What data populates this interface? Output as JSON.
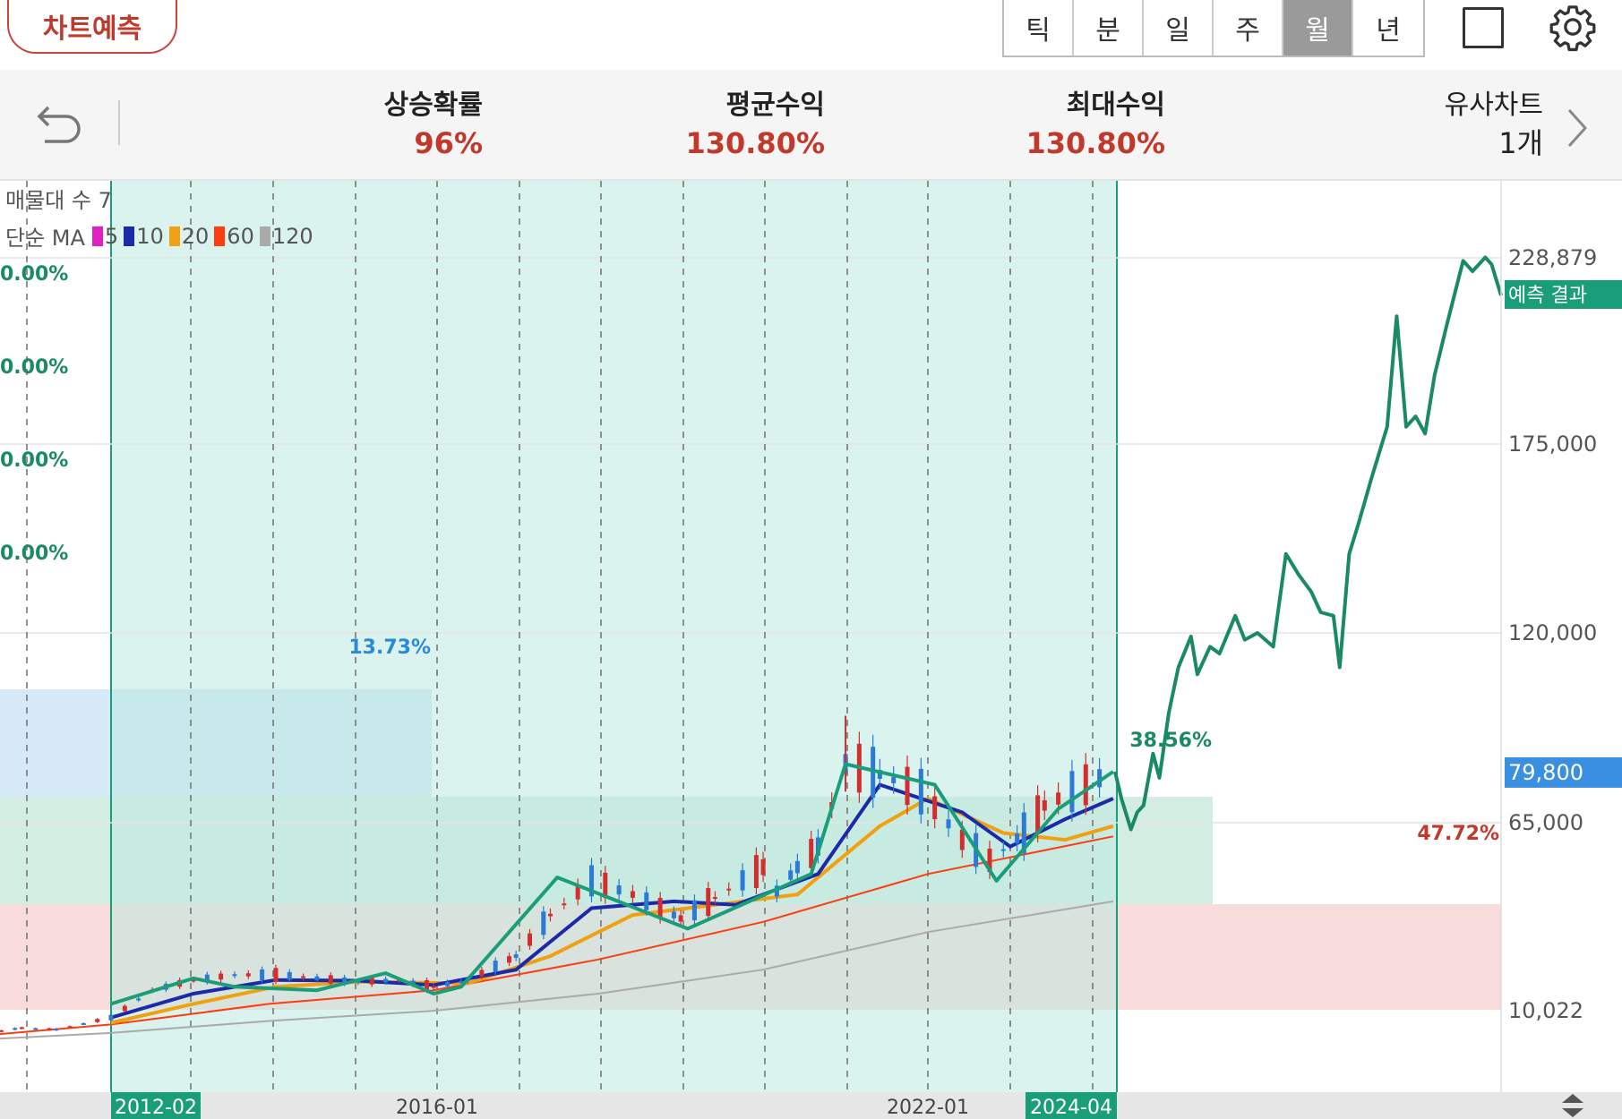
{
  "header": {
    "predict_button": "차트예측",
    "tabs": [
      {
        "label": "틱",
        "active": false
      },
      {
        "label": "분",
        "active": false
      },
      {
        "label": "일",
        "active": false
      },
      {
        "label": "주",
        "active": false
      },
      {
        "label": "월",
        "active": true
      },
      {
        "label": "년",
        "active": false
      }
    ]
  },
  "stats": {
    "rise_prob": {
      "label": "상승확률",
      "value": "96%"
    },
    "avg_return": {
      "label": "평균수익",
      "value": "130.80%"
    },
    "max_return": {
      "label": "최대수익",
      "value": "130.80%"
    },
    "similar": {
      "label": "유사차트",
      "value": "1개"
    }
  },
  "legend": {
    "volume_profile": "매물대 수 7",
    "ma_label": "단순 MA",
    "ma_items": [
      {
        "period": "5",
        "color": "#e020c0"
      },
      {
        "period": "10",
        "color": "#1a2aa8"
      },
      {
        "period": "20",
        "color": "#f0a010"
      },
      {
        "period": "60",
        "color": "#ff3c10"
      },
      {
        "period": "120",
        "color": "#aaaaaa"
      }
    ]
  },
  "chart_data": {
    "type": "line",
    "y_axis_labels": [
      "228,879",
      "175,000",
      "120,000",
      "65,000",
      "10,022"
    ],
    "y_axis_values": [
      228879,
      175000,
      120000,
      65000,
      10022
    ],
    "current_price": "79,800",
    "prediction_label": "예측 결과",
    "x_axis_labels": [
      "2012-02",
      "2016-01",
      "2022-01",
      "2024-04"
    ],
    "left_percent_labels": [
      "0.00%",
      "0.00%",
      "0.00%",
      "0.00%"
    ],
    "zone_labels": [
      "13.73%",
      "38.56%",
      "47.72%"
    ],
    "colors": {
      "zone_blue": "#d6e9f8",
      "zone_green": "#d3ede3",
      "zone_red": "#f8dcdc",
      "pattern": "#1a9e7a",
      "prediction": "#1a8a64",
      "highlight": "#bde9e0",
      "axis_badge": "#1a9e7a",
      "price_badge": "#3a8fe0"
    },
    "price_series": [
      [
        "2010-06",
        3000
      ],
      [
        "2011-01",
        5000
      ],
      [
        "2011-06",
        4500
      ],
      [
        "2012-02",
        8000
      ],
      [
        "2012-08",
        16000
      ],
      [
        "2013-02",
        19000
      ],
      [
        "2013-08",
        20500
      ],
      [
        "2014-02",
        20500
      ],
      [
        "2014-08",
        19500
      ],
      [
        "2015-02",
        18500
      ],
      [
        "2015-08",
        19000
      ],
      [
        "2016-01",
        17000
      ],
      [
        "2016-06",
        19000
      ],
      [
        "2017-01",
        26000
      ],
      [
        "2017-06",
        38000
      ],
      [
        "2017-12",
        48000
      ],
      [
        "2018-06",
        44000
      ],
      [
        "2019-01",
        37000
      ],
      [
        "2019-06",
        43000
      ],
      [
        "2020-01",
        52000
      ],
      [
        "2020-03",
        45000
      ],
      [
        "2020-06",
        52000
      ],
      [
        "2020-09",
        58000
      ],
      [
        "2021-01",
        82000
      ],
      [
        "2021-06",
        79000
      ],
      [
        "2021-12",
        74000
      ],
      [
        "2022-06",
        60000
      ],
      [
        "2022-10",
        54000
      ],
      [
        "2023-03",
        62000
      ],
      [
        "2023-06",
        70000
      ],
      [
        "2023-12",
        76000
      ],
      [
        "2024-04",
        79800
      ]
    ],
    "pattern_series": [
      [
        "2012-02",
        12000
      ],
      [
        "2013-02",
        19500
      ],
      [
        "2013-08",
        17000
      ],
      [
        "2014-08",
        16000
      ],
      [
        "2015-06",
        21000
      ],
      [
        "2016-01",
        15000
      ],
      [
        "2016-05",
        17000
      ],
      [
        "2017-07",
        49000
      ],
      [
        "2019-02",
        34000
      ],
      [
        "2020-08",
        50000
      ],
      [
        "2021-01",
        82000
      ],
      [
        "2022-02",
        76000
      ],
      [
        "2022-11",
        48000
      ],
      [
        "2023-08",
        69000
      ],
      [
        "2024-04",
        79800
      ]
    ],
    "ma_series": {
      "ma10": [
        [
          "2012-02",
          8000
        ],
        [
          "2013-02",
          15000
        ],
        [
          "2014-02",
          19000
        ],
        [
          "2015-02",
          18800
        ],
        [
          "2016-01",
          17500
        ],
        [
          "2017-01",
          22000
        ],
        [
          "2017-12",
          40000
        ],
        [
          "2018-12",
          42000
        ],
        [
          "2019-09",
          41000
        ],
        [
          "2020-09",
          50000
        ],
        [
          "2021-06",
          76000
        ],
        [
          "2022-06",
          68000
        ],
        [
          "2023-01",
          58000
        ],
        [
          "2023-09",
          66000
        ],
        [
          "2024-04",
          72000
        ]
      ],
      "ma20": [
        [
          "2012-02",
          6500
        ],
        [
          "2013-02",
          12000
        ],
        [
          "2014-02",
          17000
        ],
        [
          "2015-02",
          18500
        ],
        [
          "2016-06",
          18000
        ],
        [
          "2017-06",
          26000
        ],
        [
          "2018-06",
          38000
        ],
        [
          "2019-06",
          41000
        ],
        [
          "2020-06",
          44000
        ],
        [
          "2021-06",
          64000
        ],
        [
          "2022-01",
          72000
        ],
        [
          "2022-12",
          62000
        ],
        [
          "2023-09",
          60000
        ],
        [
          "2024-04",
          64000
        ]
      ],
      "ma60": [
        [
          "2010-06",
          2500
        ],
        [
          "2012-02",
          6000
        ],
        [
          "2014-01",
          12000
        ],
        [
          "2016-01",
          16000
        ],
        [
          "2018-01",
          25000
        ],
        [
          "2020-01",
          36000
        ],
        [
          "2022-01",
          50000
        ],
        [
          "2024-04",
          61000
        ]
      ],
      "ma120": [
        [
          "2010-06",
          1500
        ],
        [
          "2012-02",
          3500
        ],
        [
          "2014-01",
          7000
        ],
        [
          "2016-01",
          10000
        ],
        [
          "2018-01",
          15000
        ],
        [
          "2020-01",
          22000
        ],
        [
          "2022-01",
          33000
        ],
        [
          "2024-04",
          42000
        ]
      ]
    },
    "prediction_series": [
      [
        "2024-04",
        79800
      ],
      [
        "2024-06",
        72000
      ],
      [
        "2024-09",
        63000
      ],
      [
        "2024-11",
        68000
      ],
      [
        "2025-01",
        70000
      ],
      [
        "2025-04",
        85000
      ],
      [
        "2025-06",
        78000
      ],
      [
        "2025-09",
        97000
      ],
      [
        "2025-12",
        110000
      ],
      [
        "2026-04",
        119000
      ],
      [
        "2026-06",
        108000
      ],
      [
        "2026-10",
        116000
      ],
      [
        "2027-01",
        114000
      ],
      [
        "2027-06",
        125000
      ],
      [
        "2027-09",
        118000
      ],
      [
        "2028-01",
        120000
      ],
      [
        "2028-06",
        116000
      ],
      [
        "2028-10",
        143000
      ],
      [
        "2029-02",
        137000
      ],
      [
        "2029-06",
        132000
      ],
      [
        "2029-09",
        126000
      ],
      [
        "2030-01",
        125000
      ],
      [
        "2030-03",
        110000
      ],
      [
        "2030-06",
        143000
      ],
      [
        "2030-09",
        152000
      ],
      [
        "2031-01",
        165000
      ],
      [
        "2031-06",
        180000
      ],
      [
        "2031-09",
        212000
      ],
      [
        "2031-12",
        180000
      ],
      [
        "2032-03",
        183000
      ],
      [
        "2032-06",
        178000
      ],
      [
        "2032-09",
        195000
      ],
      [
        "2033-01",
        210000
      ],
      [
        "2033-06",
        228000
      ],
      [
        "2033-09",
        225000
      ],
      [
        "2034-01",
        229000
      ],
      [
        "2034-03",
        227000
      ],
      [
        "2034-06",
        218000
      ]
    ]
  }
}
